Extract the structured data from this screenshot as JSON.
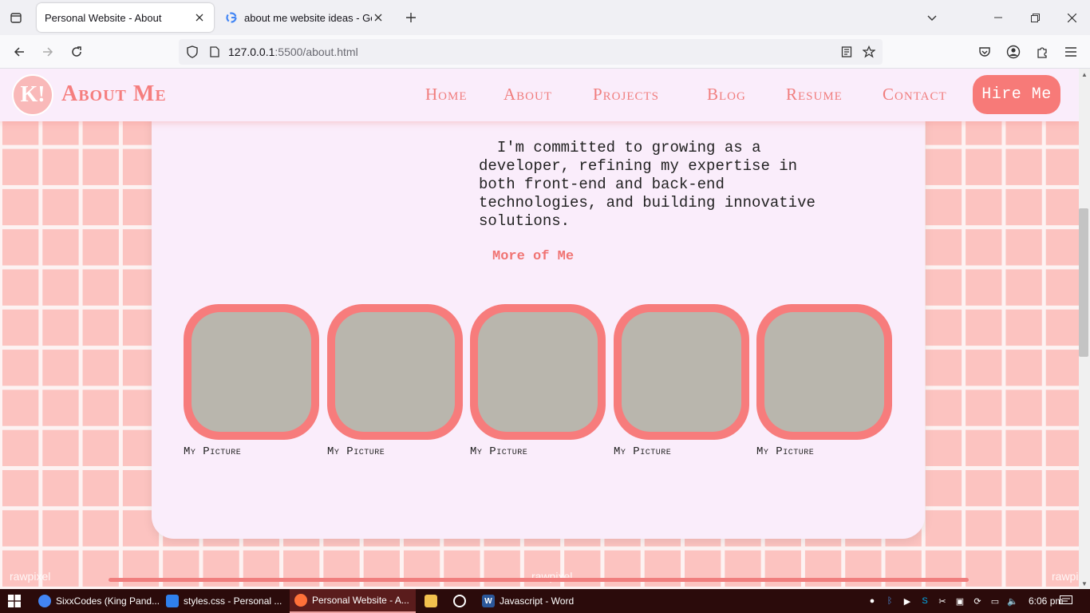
{
  "browser": {
    "tabs": [
      {
        "title": "Personal Website - About",
        "active": true
      },
      {
        "title": "about me website ideas - Googl",
        "active": false
      }
    ],
    "url_host": "127.0.0.1",
    "url_rest": ":5500/about.html"
  },
  "site": {
    "logo_text": "K!",
    "title": "About Me",
    "nav": [
      "Home",
      "About",
      "Projects",
      "Blog",
      "Resume",
      "Contact"
    ],
    "hire_label": "Hire Me"
  },
  "content": {
    "intro": "  I'm committed to growing as a\ndeveloper, refining my expertise in\nboth front-end and back-end\ntechnologies, and building innovative\nsolutions.",
    "more_heading": "More of Me",
    "photos": [
      {
        "caption": "My Picture"
      },
      {
        "caption": "My Picture"
      },
      {
        "caption": "My Picture"
      },
      {
        "caption": "My Picture"
      },
      {
        "caption": "My Picture"
      }
    ],
    "watermark": "rawpixel"
  },
  "taskbar": {
    "apps": [
      {
        "label": "SixxCodes (King Pand...",
        "icon": "chrome-icon",
        "color": "#4285f4"
      },
      {
        "label": "styles.css - Personal ...",
        "icon": "vscode-icon",
        "color": "#2f80ed"
      },
      {
        "label": "Personal Website - A...",
        "icon": "firefox-icon",
        "color": "#ff7139"
      },
      {
        "label": "",
        "icon": "folder-icon",
        "color": "#f2c14e"
      },
      {
        "label": "",
        "icon": "record-icon",
        "color": "#ffffff"
      },
      {
        "label": "Javascript - Word",
        "icon": "word-icon",
        "color": "#2b579a"
      }
    ],
    "time": "6:06 pm"
  }
}
